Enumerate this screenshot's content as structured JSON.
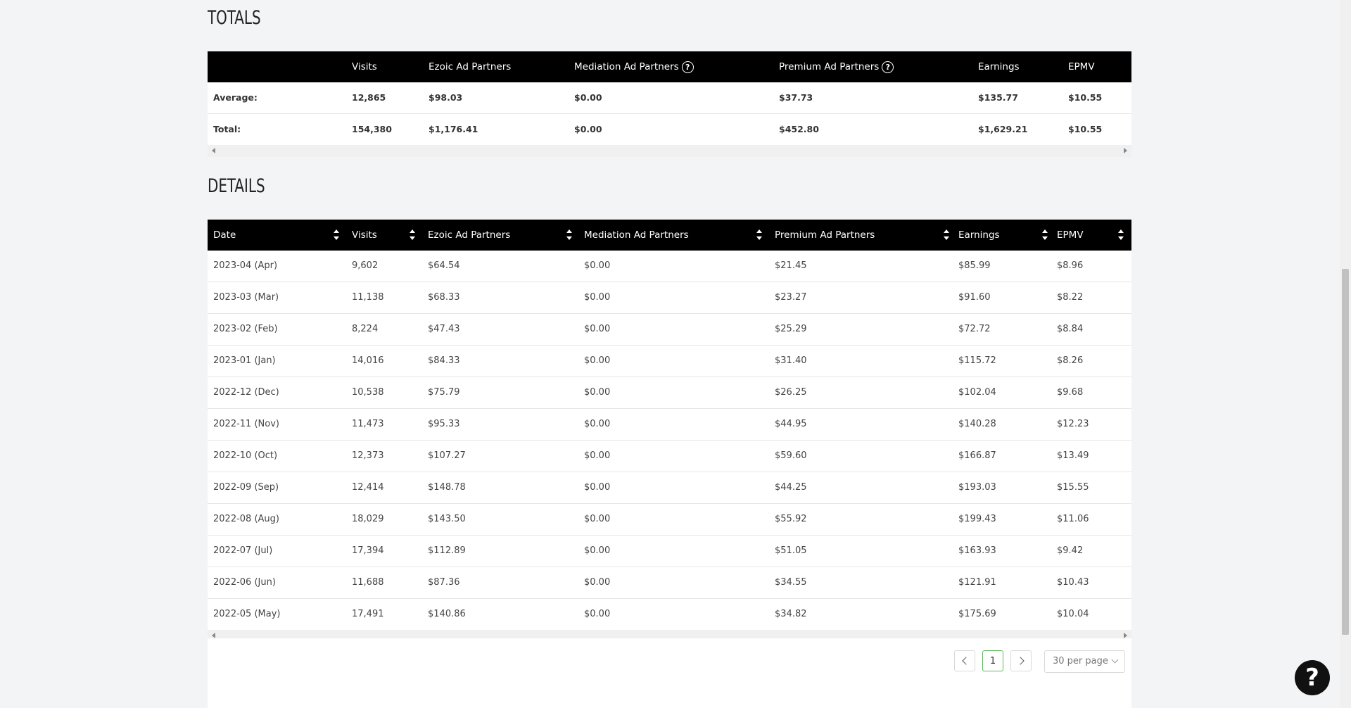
{
  "totals": {
    "title": "TOTALS",
    "columns": [
      "",
      "Visits",
      "Ezoic Ad Partners",
      "Mediation Ad Partners",
      "Premium Ad Partners",
      "Earnings",
      "EPMV"
    ],
    "rows": [
      {
        "label": "Average:",
        "visits": "12,865",
        "ezoic": "$98.03",
        "mediation": "$0.00",
        "premium": "$37.73",
        "earnings": "$135.77",
        "epmv": "$10.55"
      },
      {
        "label": "Total:",
        "visits": "154,380",
        "ezoic": "$1,176.41",
        "mediation": "$0.00",
        "premium": "$452.80",
        "earnings": "$1,629.21",
        "epmv": "$10.55"
      }
    ]
  },
  "details": {
    "title": "DETAILS",
    "columns": [
      "Date",
      "Visits",
      "Ezoic Ad Partners",
      "Mediation Ad Partners",
      "Premium Ad Partners",
      "Earnings",
      "EPMV"
    ],
    "rows": [
      [
        "2023-04 (Apr)",
        "9,602",
        "$64.54",
        "$0.00",
        "$21.45",
        "$85.99",
        "$8.96"
      ],
      [
        "2023-03 (Mar)",
        "11,138",
        "$68.33",
        "$0.00",
        "$23.27",
        "$91.60",
        "$8.22"
      ],
      [
        "2023-02 (Feb)",
        "8,224",
        "$47.43",
        "$0.00",
        "$25.29",
        "$72.72",
        "$8.84"
      ],
      [
        "2023-01 (Jan)",
        "14,016",
        "$84.33",
        "$0.00",
        "$31.40",
        "$115.72",
        "$8.26"
      ],
      [
        "2022-12 (Dec)",
        "10,538",
        "$75.79",
        "$0.00",
        "$26.25",
        "$102.04",
        "$9.68"
      ],
      [
        "2022-11 (Nov)",
        "11,473",
        "$95.33",
        "$0.00",
        "$44.95",
        "$140.28",
        "$12.23"
      ],
      [
        "2022-10 (Oct)",
        "12,373",
        "$107.27",
        "$0.00",
        "$59.60",
        "$166.87",
        "$13.49"
      ],
      [
        "2022-09 (Sep)",
        "12,414",
        "$148.78",
        "$0.00",
        "$44.25",
        "$193.03",
        "$15.55"
      ],
      [
        "2022-08 (Aug)",
        "18,029",
        "$143.50",
        "$0.00",
        "$55.92",
        "$199.43",
        "$11.06"
      ],
      [
        "2022-07 (Jul)",
        "17,394",
        "$112.89",
        "$0.00",
        "$51.05",
        "$163.93",
        "$9.42"
      ],
      [
        "2022-06 (Jun)",
        "11,688",
        "$87.36",
        "$0.00",
        "$34.55",
        "$121.91",
        "$10.43"
      ],
      [
        "2022-05 (May)",
        "17,491",
        "$140.86",
        "$0.00",
        "$34.82",
        "$175.69",
        "$10.04"
      ]
    ]
  },
  "pagination": {
    "current_page": "1",
    "per_page": "30 per page"
  },
  "help_button": "?"
}
